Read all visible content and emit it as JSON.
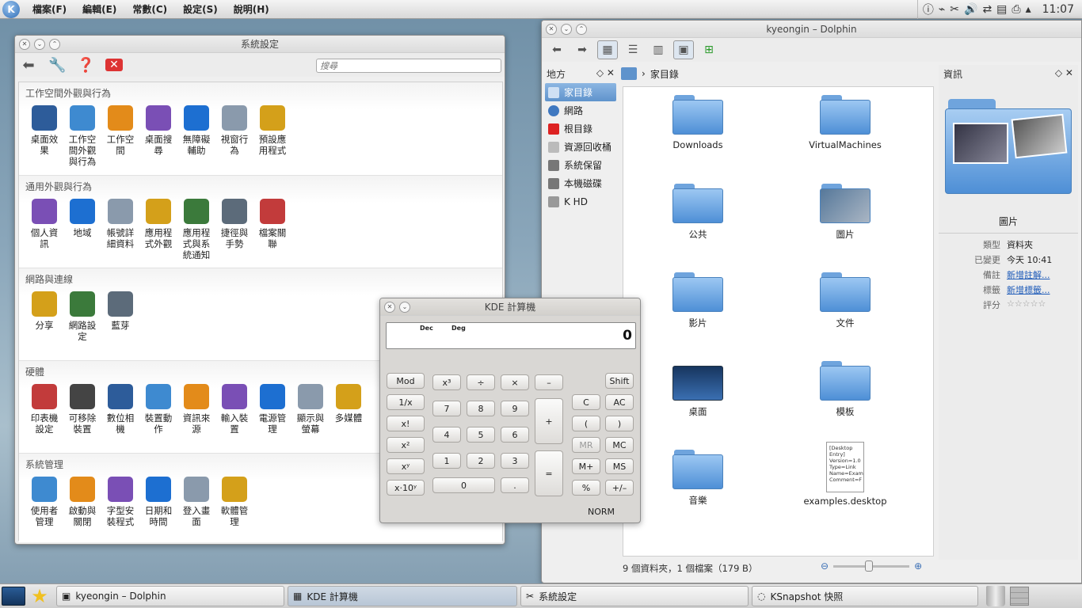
{
  "menubar": {
    "items": [
      "檔案(F)",
      "編輯(E)",
      "常數(C)",
      "設定(S)",
      "說明(H)"
    ],
    "clock": "11:07"
  },
  "settings": {
    "title": "系統設定",
    "search_placeholder": "搜尋",
    "categories": [
      {
        "title": "工作空間外觀與行為",
        "items": [
          "桌面效\n果",
          "工作空\n間外觀\n與行為",
          "工作空\n間",
          "桌面搜\n尋",
          "無障礙\n輔助",
          "視窗行\n為",
          "預設應\n用程式"
        ]
      },
      {
        "title": "通用外觀與行為",
        "items": [
          "個人資\n訊",
          "地域",
          "帳號詳\n細資料",
          "應用程\n式外觀",
          "應用程\n式與系\n統通知",
          "捷徑與\n手勢",
          "檔案關\n聯"
        ]
      },
      {
        "title": "網路與連線",
        "items": [
          "分享",
          "網路設\n定",
          "藍芽"
        ]
      },
      {
        "title": "硬體",
        "items": [
          "印表機\n設定",
          "可移除\n裝置",
          "數位相\n機",
          "裝置動\n作",
          "資訊來\n源",
          "輸入裝\n置",
          "電源管\n理",
          "顯示與\n螢幕",
          "多媒體"
        ]
      },
      {
        "title": "系統管理",
        "items": [
          "使用者\n管理",
          "啟動與\n關閉",
          "字型安\n裝程式",
          "日期和\n時間",
          "登入畫\n面",
          "軟體管\n理"
        ]
      }
    ]
  },
  "dolphin": {
    "title": "kyeongin – Dolphin",
    "places_title": "地方",
    "places": [
      "家目錄",
      "網路",
      "根目錄",
      "資源回收桶",
      "系統保留",
      "本機磁碟",
      "K HD"
    ],
    "breadcrumb": "家目錄",
    "files": [
      "Downloads",
      "VirtualMachines",
      "公共",
      "圖片",
      "影片",
      "文件",
      "桌面",
      "模板",
      "音樂",
      "examples.desktop"
    ],
    "desktop_preview": "[Desktop Entry]\nVersion=1.0\nType=Link\nName=Examples\nComment=F",
    "status": "9 個資料夾，1 個檔案（179 B）",
    "info": {
      "title": "資訊",
      "name": "圖片",
      "rows": [
        {
          "k": "類型",
          "v": "資料夾"
        },
        {
          "k": "已變更",
          "v": "今天 10:41"
        },
        {
          "k": "備註",
          "v": "新增註解..."
        },
        {
          "k": "標籤",
          "v": "新增標籤..."
        },
        {
          "k": "評分",
          "v": "☆☆☆☆☆"
        }
      ]
    }
  },
  "calculator": {
    "title": "KDE 計算機",
    "display_labels": [
      "Dec",
      "Deg"
    ],
    "value": "0",
    "keys": {
      "mod": "Mod",
      "cube": "x³",
      "div": "÷",
      "mul": "×",
      "minus": "–",
      "shift": "Shift",
      "inv": "1/x",
      "c": "C",
      "ac": "AC",
      "fact": "x!",
      "lp": "(",
      "rp": ")",
      "sq": "x²",
      "mr": "MR",
      "mc": "MC",
      "pow": "xʸ",
      "mplus": "M+",
      "ms": "MS",
      "exp": "x·10ʸ",
      "pct": "%",
      "pm": "+/–",
      "plus": "+",
      "eq": "=",
      "dot": ".",
      "n0": "0",
      "n1": "1",
      "n2": "2",
      "n3": "3",
      "n4": "4",
      "n5": "5",
      "n6": "6",
      "n7": "7",
      "n8": "8",
      "n9": "9"
    },
    "mode": "NORM"
  },
  "taskbar": {
    "tasks": [
      "kyeongin – Dolphin",
      "KDE 計算機",
      "系統設定",
      "KSnapshot 快照"
    ]
  },
  "colors": {
    "accent": "#5f93cc",
    "folder": "#6fa4dd"
  }
}
